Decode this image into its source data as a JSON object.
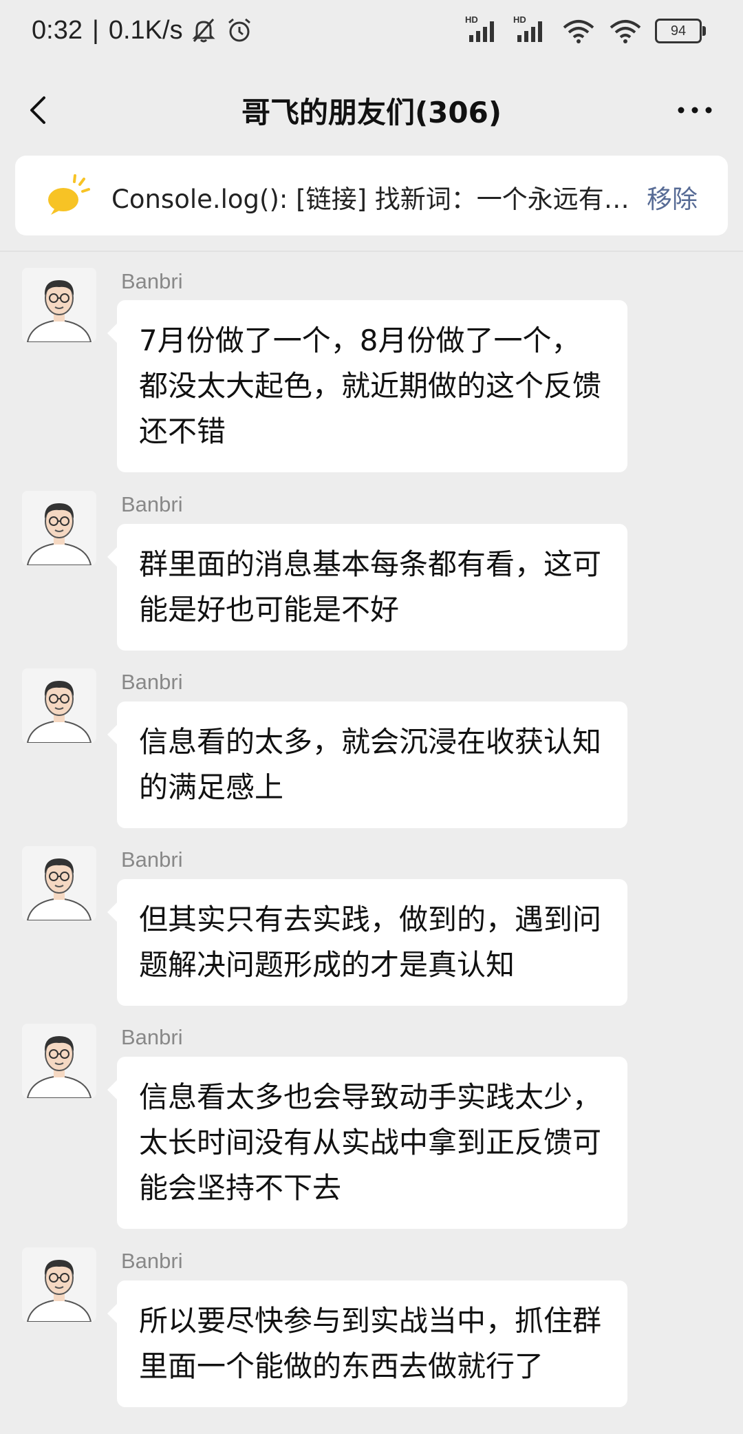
{
  "status_bar": {
    "time": "0:32",
    "separator": "|",
    "speed": "0.1K/s",
    "battery": "94",
    "hd_label_1": "HD",
    "hd_label_2": "HD"
  },
  "nav": {
    "title": "哥飞的朋友们(306)"
  },
  "pinned": {
    "text": "Console.log(): [链接] 找新词：一个永远有…",
    "remove_label": "移除"
  },
  "messages": [
    {
      "sender": "Banbri",
      "text": "7月份做了一个，8月份做了一个，都没太大起色，就近期做的这个反馈还不错"
    },
    {
      "sender": "Banbri",
      "text": "群里面的消息基本每条都有看，这可能是好也可能是不好"
    },
    {
      "sender": "Banbri",
      "text": "信息看的太多，就会沉浸在收获认知的满足感上"
    },
    {
      "sender": "Banbri",
      "text": "但其实只有去实践，做到的，遇到问题解决问题形成的才是真认知"
    },
    {
      "sender": "Banbri",
      "text": "信息看太多也会导致动手实践太少，太长时间没有从实战中拿到正反馈可能会坚持不下去"
    },
    {
      "sender": "Banbri",
      "text": "所以要尽快参与到实战当中，抓住群里面一个能做的东西去做就行了"
    }
  ],
  "icons": {
    "back": "chevron-left-icon",
    "more": "more-dots-icon",
    "pinned": "speech-bubble-icon",
    "mute": "bell-muted-icon",
    "alarm": "alarm-clock-icon",
    "signal": "signal-icon",
    "wifi": "wifi-icon",
    "battery": "battery-icon"
  },
  "colors": {
    "background": "#ededed",
    "bubble": "#ffffff",
    "link": "#576b95",
    "pinned_icon": "#f7c325"
  }
}
